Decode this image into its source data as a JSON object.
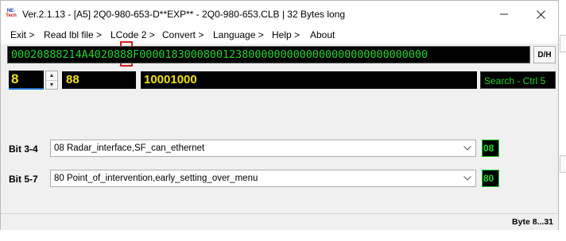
{
  "window": {
    "title": "Ver.2.1.13 - [A5] 2Q0-980-653-D**EXP** - 2Q0-980-653.CLB | 32 Bytes long",
    "logo_line1": "NE-",
    "logo_line2": "Tech",
    "minimize_glyph": "—",
    "maximize_glyph": "☐",
    "close_glyph": "✕"
  },
  "menu": {
    "items": [
      "Exit >",
      "Read lbl file >",
      "LCode 2 >",
      "Convert >",
      "Language >",
      "Help >",
      "About"
    ]
  },
  "hex": {
    "value": "00020888214A4020888F000018300080012380000000000000000000000000000",
    "toggle_label": "D/H"
  },
  "byte": {
    "index": "8",
    "hex_value": "88",
    "binary_value": "10001000",
    "search_label": "Search - Ctrl 5"
  },
  "bit_fields": [
    {
      "label": "Bit 3-4",
      "selected": "08 Radar_interface,SF_can_ethernet",
      "value": "08"
    },
    {
      "label": "Bit 5-7",
      "selected": "80 Point_of_intervention,early_setting_over_menu",
      "value": "80"
    }
  ],
  "status": {
    "byte_range": "Byte 8...31"
  },
  "colors": {
    "hex_green": "#1fd72e",
    "value_yellow": "#f2e312",
    "marker_red": "#d81f1f",
    "focus_blue": "#1f6fd1"
  }
}
